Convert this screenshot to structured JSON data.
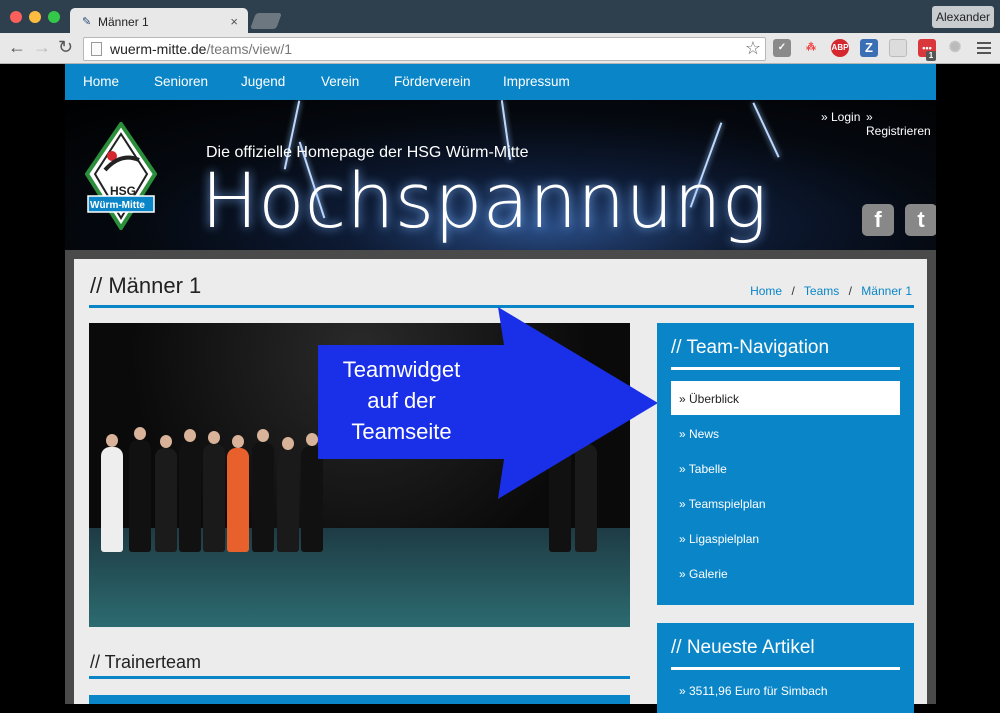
{
  "browser": {
    "tab_title": "Männer 1",
    "tab_close": "×",
    "profile_name": "Alexander",
    "url_domain": "wuerm-mitte.de",
    "url_path": "/teams/view/1",
    "back_glyph": "←",
    "forward_glyph": "→",
    "reload_glyph": "↻",
    "star_glyph": "☆",
    "favicon": "✎",
    "extensions": [
      "✓",
      "⁂",
      "ABP",
      "Z",
      "",
      "•••",
      "✺"
    ],
    "badge": "1"
  },
  "nav": {
    "items": [
      "Home",
      "Senioren",
      "Jugend",
      "Verein",
      "Förderverein",
      "Impressum"
    ]
  },
  "banner": {
    "subtitle": "Die offizielle Homepage der HSG Würm-Mitte",
    "title": "Hochspannung",
    "login": "» Login",
    "register": "» Registrieren",
    "logo_top": "HSG",
    "logo_bottom": "Würm-Mitte",
    "facebook": "f",
    "twitter": "t"
  },
  "page": {
    "title": "// Männer 1",
    "breadcrumbs": [
      "Home",
      "Teams",
      "Männer 1"
    ],
    "breadcrumb_sep": "/",
    "section2": "// Trainerteam"
  },
  "annotation": {
    "line1": "Teamwidget",
    "line2": "auf der",
    "line3": "Teamseite"
  },
  "team_nav": {
    "title": "// Team-Navigation",
    "items": [
      "» Überblick",
      "» News",
      "» Tabelle",
      "» Teamspielplan",
      "» Ligaspielplan",
      "» Galerie"
    ]
  },
  "latest": {
    "title": "// Neueste Artikel",
    "item": "» 3511,96 Euro für Simbach"
  },
  "colors": {
    "brand_blue": "#0a86c8",
    "arrow_blue": "#1a2fe8"
  }
}
